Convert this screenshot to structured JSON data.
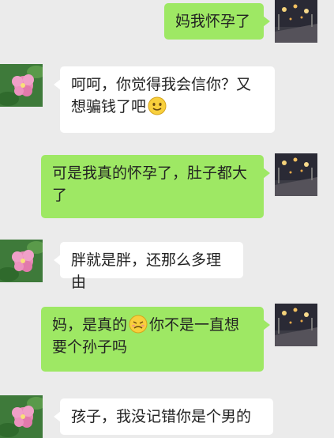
{
  "messages": [
    {
      "side": "right",
      "avatar_icon": "night-street-avatar-icon",
      "text": "妈我怀孕了"
    },
    {
      "side": "left",
      "avatar_icon": "pink-flower-avatar-icon",
      "text_before": "呵呵，你觉得我会信你？又想骗钱了吧",
      "emoji": "smile-emoji-icon"
    },
    {
      "side": "right",
      "avatar_icon": "night-street-avatar-icon",
      "text": "可是我真的怀孕了，肚子都大了"
    },
    {
      "side": "left",
      "avatar_icon": "pink-flower-avatar-icon",
      "text": "胖就是胖，还那么多理由"
    },
    {
      "side": "right",
      "avatar_icon": "night-street-avatar-icon",
      "text_before": "妈，是真的",
      "emoji": "sad-emoji-icon",
      "text_after": "你不是一直想要个孙子吗"
    },
    {
      "side": "left",
      "avatar_icon": "pink-flower-avatar-icon",
      "text": "孩子，我没记错你是个男的"
    }
  ],
  "colors": {
    "background": "#ebebeb",
    "sent_bubble": "#9ee864",
    "received_bubble": "#ffffff"
  }
}
